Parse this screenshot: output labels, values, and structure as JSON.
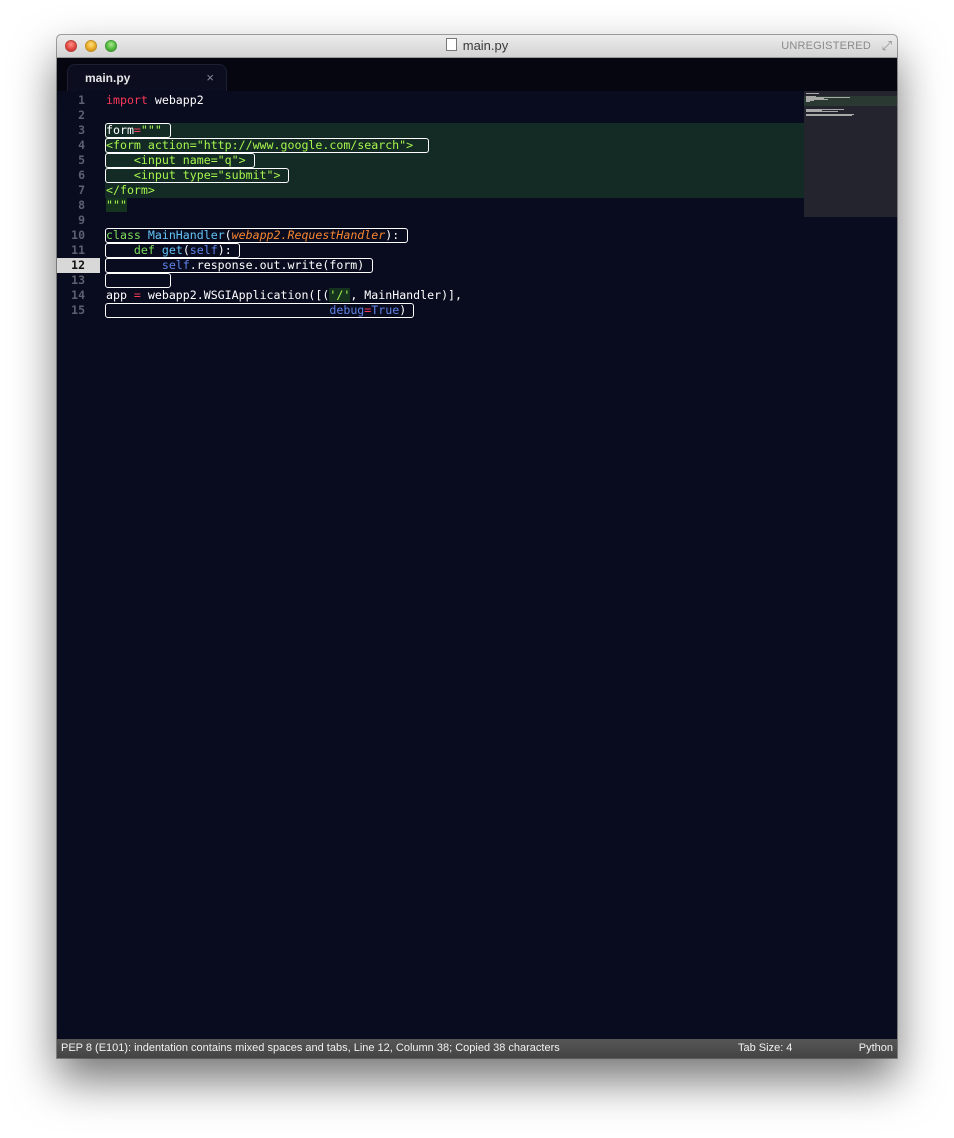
{
  "window": {
    "title": "main.py",
    "registration": "UNREGISTERED"
  },
  "tab": {
    "label": "main.py",
    "close_glyph": "×"
  },
  "gutter": {
    "line_numbers": [
      "1",
      "2",
      "3",
      "4",
      "5",
      "6",
      "7",
      "8",
      "9",
      "10",
      "11",
      "12",
      "13",
      "14",
      "15"
    ],
    "current_line": "12"
  },
  "code": {
    "l1_kw": "import",
    "l1_rest": " webapp2",
    "l3_name": "form",
    "l3_op": "=",
    "l3_quote": "\"\"\"",
    "l4": "<form action=\"http://www.google.com/search\">",
    "l5": "    <input name=\"q\">",
    "l6": "    <input type=\"submit\">",
    "l7": "</form>",
    "l8": "\"\"\"",
    "l10_kw": "class",
    "l10_name": "MainHandler",
    "l10_paren_open": "(",
    "l10_base": "webapp2.RequestHandler",
    "l10_paren_close": "):",
    "l11_indent": "    ",
    "l11_kw": "def",
    "l11_name": "get",
    "l11_paren_open": "(",
    "l11_self": "self",
    "l11_paren_close": "):",
    "l12_indent": "        ",
    "l12_self": "self",
    "l12_rest": ".response.out.write(form)",
    "l14_name": "app ",
    "l14_op": "=",
    "l14_mid": " webapp2.WSGIApplication([(",
    "l14_str": "'/'",
    "l14_end": ", MainHandler)],",
    "l15_indent": "                                ",
    "l15_kwarg": "debug",
    "l15_op": "=",
    "l15_val": "True",
    "l15_close": ")"
  },
  "status": {
    "message": "PEP 8 (E101): indentation contains mixed spaces and tabs, Line 12, Column 38; Copied 38 characters",
    "tab_size": "Tab Size: 4",
    "syntax": "Python"
  },
  "colors": {
    "background": "#090b1e",
    "keyword": "#f8395a",
    "string": "#a5f54e",
    "class_name": "#63c2f5",
    "parameter": "#f78732",
    "self": "#5f84e8"
  },
  "icons": [
    "close-traffic-light",
    "minimize-traffic-light",
    "zoom-traffic-light",
    "document-icon",
    "fullscreen-icon",
    "tab-close-icon"
  ]
}
